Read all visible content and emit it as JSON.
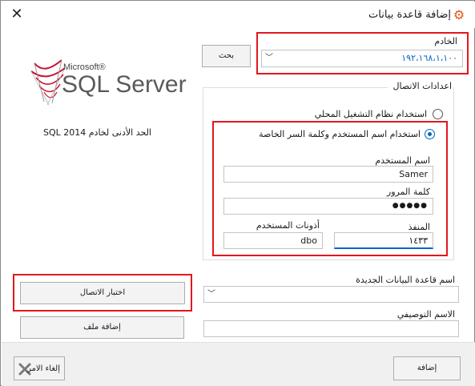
{
  "window": {
    "title": "إضافة قاعدة بيانات"
  },
  "logo": {
    "brand": "Microsoft®",
    "product": "SQL Server"
  },
  "requirement_note": "الحد الأدنى لخادم SQL 2014",
  "server": {
    "label": "الخادم",
    "value": "١٩٢،١٦٨،١،١٠٠",
    "search_label": "بحث"
  },
  "connection": {
    "group_label": "اعدادات الاتصال",
    "os_auth_label": "استخدام نظام التشغيل المحلي",
    "sql_auth_label": "استخدام اسم المستخدم وكلمة السر الخاصة",
    "selected": "sql_auth",
    "username_label": "اسم المستخدم",
    "username_value": "Samer",
    "password_label": "كلمة المرور",
    "password_value": "●●●●●",
    "port_label": "المنفذ",
    "port_value": "١٤٣٣",
    "schema_label": "أذونات المستخدم",
    "schema_value": "dbo"
  },
  "new_db": {
    "label": "اسم قاعدة البيانات الجديدة",
    "value": ""
  },
  "description": {
    "label": "الاسم التوصيفي",
    "value": ""
  },
  "buttons": {
    "test": "اختبار الاتصال",
    "add_file": "إضافة ملف",
    "add": "إضافة",
    "cancel": "إلغاء الامر"
  },
  "colors": {
    "highlight": "#e3171d",
    "accent": "#0067c0",
    "icon": "#e0581c"
  }
}
